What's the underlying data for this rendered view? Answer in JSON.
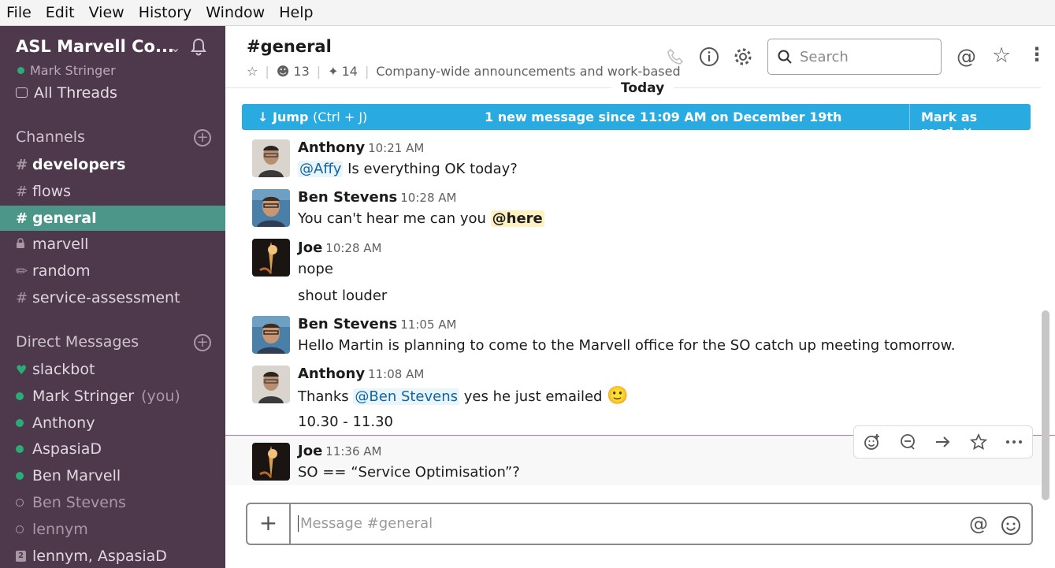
{
  "menu": [
    "File",
    "Edit",
    "View",
    "History",
    "Window",
    "Help"
  ],
  "workspace": {
    "name": "ASL Marvell Co...",
    "user": "Mark Stringer",
    "all_threads": "All Threads"
  },
  "channels": {
    "title": "Channels",
    "items": [
      {
        "prefix": "#",
        "label": "developers",
        "style": "bold"
      },
      {
        "prefix": "#",
        "label": "flows",
        "style": "normal"
      },
      {
        "prefix": "#",
        "label": "general",
        "style": "active"
      },
      {
        "prefix": "lock",
        "label": "marvell",
        "style": "normal"
      },
      {
        "prefix": "pencil",
        "label": "random",
        "style": "normal"
      },
      {
        "prefix": "#",
        "label": "service-assessment",
        "style": "normal"
      }
    ]
  },
  "direct_messages": {
    "title": "Direct Messages",
    "items": [
      {
        "label": "slackbot",
        "status": "heart"
      },
      {
        "label": "Mark Stringer",
        "suffix": "(you)",
        "status": "online"
      },
      {
        "label": "Anthony",
        "status": "online"
      },
      {
        "label": "AspasiaD",
        "status": "online"
      },
      {
        "label": "Ben Marvell",
        "status": "online"
      },
      {
        "label": "Ben Stevens",
        "status": "away"
      },
      {
        "label": "lennym",
        "status": "away"
      },
      {
        "label": "lennym, AspasiaD",
        "status": "group",
        "badge": "2"
      }
    ]
  },
  "header": {
    "title": "#general",
    "members": "13",
    "pins": "14",
    "topic": "Company-wide announcements and work-based",
    "search_placeholder": "Search"
  },
  "divider": "Today",
  "banner": {
    "jump": "Jump",
    "jump_keys": "(Ctrl + J)",
    "message": "1 new message since 11:09 AM on December 19th",
    "mark": "Mark as read"
  },
  "messages": [
    {
      "author": "Anthony",
      "time": "10:21 AM",
      "mention": "@Affy",
      "text": "Is everything OK today?"
    },
    {
      "author": "Ben Stevens",
      "time": "10:28 AM",
      "text": "You can't hear me can you",
      "here": "@here"
    },
    {
      "author": "Joe",
      "time": "10:28 AM",
      "text": "nope",
      "followup": "shout louder"
    },
    {
      "author": "Ben Stevens",
      "time": "11:05 AM",
      "text": "Hello Martin is planning to come to the Marvell office for the SO catch up meeting tomorrow."
    },
    {
      "author": "Anthony",
      "time": "11:08 AM",
      "pre": "Thanks",
      "mention": "@Ben Stevens",
      "text": "yes he just emailed",
      "emoji": "🙂",
      "followup": "10.30 - 11.30"
    },
    {
      "author": "Joe",
      "time": "11:36 AM",
      "text": "SO == “Service Optimisation”?"
    }
  ],
  "composer": {
    "placeholder": "Message #general"
  },
  "colors": {
    "sidebar": "#4d394b",
    "active": "#4c9689",
    "banner": "#29abe2",
    "presence": "#2bac76"
  }
}
